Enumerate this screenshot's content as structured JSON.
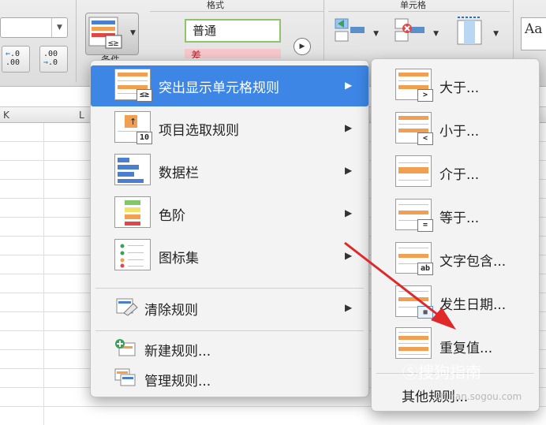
{
  "ribbon": {
    "format_header": "格式",
    "cells_header": "单元格",
    "conditional_label": "条件",
    "style_normal": "普通",
    "style_bad": "差",
    "increase_decimal": {
      "top": ".0",
      "bottom": ".00"
    },
    "decrease_decimal": {
      "top": ".00",
      "bottom": ".0"
    },
    "theme_preview": "Aa"
  },
  "sheet": {
    "columns": [
      "K",
      "L"
    ]
  },
  "main_menu": {
    "items": [
      {
        "label": "突出显示单元格规则",
        "icon": "highlight-rules-icon",
        "has_submenu": true,
        "highlighted": true
      },
      {
        "label": "项目选取规则",
        "icon": "top-bottom-rules-icon",
        "has_submenu": true
      },
      {
        "label": "数据栏",
        "icon": "data-bars-icon",
        "has_submenu": true
      },
      {
        "label": "色阶",
        "icon": "color-scales-icon",
        "has_submenu": true
      },
      {
        "label": "图标集",
        "icon": "icon-sets-icon",
        "has_submenu": true
      },
      {
        "label": "清除规则",
        "icon": "clear-rules-icon",
        "has_submenu": true
      },
      {
        "label": "新建规则...",
        "icon": "new-rule-icon"
      },
      {
        "label": "管理规则...",
        "icon": "manage-rules-icon"
      }
    ]
  },
  "sub_menu": {
    "items": [
      {
        "label": "大于...",
        "icon": "greater-than-icon",
        "tag": ">"
      },
      {
        "label": "小于...",
        "icon": "less-than-icon",
        "tag": "<"
      },
      {
        "label": "介于...",
        "icon": "between-icon"
      },
      {
        "label": "等于...",
        "icon": "equal-to-icon",
        "tag": "="
      },
      {
        "label": "文字包含...",
        "icon": "text-contains-icon",
        "tag": "ab"
      },
      {
        "label": "发生日期...",
        "icon": "date-occurring-icon"
      },
      {
        "label": "重复值...",
        "icon": "duplicate-values-icon"
      },
      {
        "label": "其他规则...",
        "icon": ""
      }
    ]
  },
  "watermark": {
    "text": "搜狗指南",
    "url_text": "zhinan.sogou.com"
  },
  "colors": {
    "highlight": "#3d86e6",
    "menu_bg": "#f3f3f3",
    "annotation_arrow": "#e0282a",
    "band_orange": "#f0a050",
    "band_blue": "#4a7fd0"
  }
}
